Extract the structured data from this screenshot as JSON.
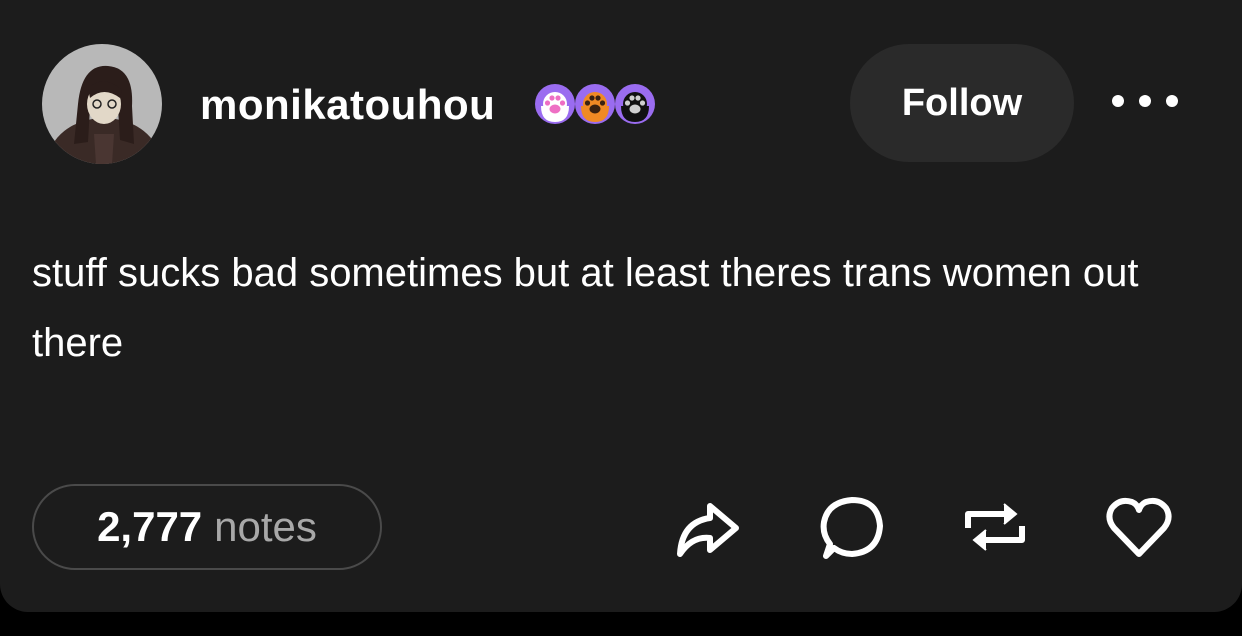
{
  "post": {
    "username": "monikatouhou",
    "avatar_icon": "avatar-image",
    "badges": [
      {
        "name": "pink-paw-badge-icon",
        "ring": "#9a6cf0",
        "fill": "#ffffff",
        "paw": "#ee6fc4"
      },
      {
        "name": "orange-paw-badge-icon",
        "ring": "#9a6cf0",
        "fill": "#f08a24",
        "paw": "#3a2210"
      },
      {
        "name": "black-paw-badge-icon",
        "ring": "#9a6cf0",
        "fill": "#111111",
        "paw": "#cfcfcf"
      }
    ],
    "follow_label": "Follow",
    "more_icon": "more-dots-icon",
    "text": "stuff sucks bad sometimes but at least theres trans women out there",
    "notes_count": "2,777",
    "notes_label": "notes",
    "actions": [
      "share-icon",
      "reply-icon",
      "reblog-icon",
      "like-icon"
    ]
  },
  "colors": {
    "background": "#1c1c1c",
    "text": "#ffffff",
    "muted": "#a8a8a8",
    "button": "#2a2a2a"
  }
}
